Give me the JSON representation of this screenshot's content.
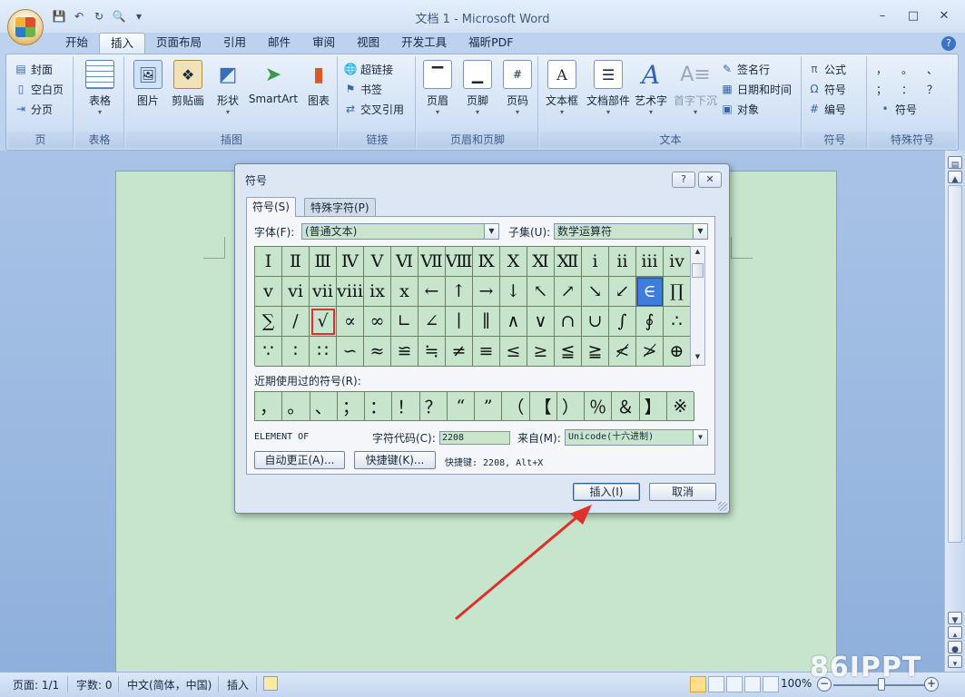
{
  "window": {
    "title": "文档 1 - Microsoft Word",
    "minimize": "–",
    "maximize": "□",
    "close": "✕"
  },
  "qat": {
    "save": "💾",
    "undo": "↶",
    "redo": "↻",
    "print_preview": "🔍",
    "customize": "▾"
  },
  "tabs": [
    "开始",
    "插入",
    "页面布局",
    "引用",
    "邮件",
    "审阅",
    "视图",
    "开发工具",
    "福昕PDF"
  ],
  "active_tab": "插入",
  "help": "?",
  "ribbon": {
    "page": {
      "label": "页",
      "items": [
        "封面",
        "空白页",
        "分页"
      ]
    },
    "table": {
      "label": "表格",
      "button": "表格"
    },
    "illustrations": {
      "label": "插图",
      "items": [
        "图片",
        "剪贴画",
        "形状",
        "SmartArt",
        "图表"
      ]
    },
    "links": {
      "label": "链接",
      "items": [
        "超链接",
        "书签",
        "交叉引用"
      ]
    },
    "header_footer": {
      "label": "页眉和页脚",
      "items": [
        "页眉",
        "页脚",
        "页码"
      ]
    },
    "text": {
      "label": "文本",
      "items": [
        "文本框",
        "文档部件",
        "艺术字",
        "首字下沉"
      ],
      "small": [
        "签名行",
        "日期和时间",
        "对象"
      ]
    },
    "symbols": {
      "label": "符号",
      "items": [
        "公式",
        "符号",
        "编号"
      ]
    },
    "special": {
      "label": "特殊符号",
      "glyphs": [
        "，",
        "。",
        "、",
        "；",
        "：",
        "？"
      ],
      "button": "符号"
    }
  },
  "dialog": {
    "title": "符号",
    "help": "?",
    "close": "✕",
    "tabs": [
      "符号(S)",
      "特殊字符(P)"
    ],
    "font_label": "字体(F):",
    "font_value": "(普通文本)",
    "subset_label": "子集(U):",
    "subset_value": "数学运算符",
    "symbols": [
      "Ⅰ",
      "Ⅱ",
      "Ⅲ",
      "Ⅳ",
      "Ⅴ",
      "Ⅵ",
      "Ⅶ",
      "Ⅷ",
      "Ⅸ",
      "Ⅹ",
      "Ⅺ",
      "Ⅻ",
      "ⅰ",
      "ⅱ",
      "ⅲ",
      "ⅳ",
      "ⅴ",
      "ⅵ",
      "ⅶ",
      "ⅷ",
      "ⅸ",
      "ⅹ",
      "←",
      "↑",
      "→",
      "↓",
      "↖",
      "↗",
      "↘",
      "↙",
      "∈",
      "∏",
      "∑",
      "∕",
      "√",
      "∝",
      "∞",
      "∟",
      "∠",
      "∣",
      "∥",
      "∧",
      "∨",
      "∩",
      "∪",
      "∫",
      "∮",
      "∴",
      "∵",
      "∶",
      "∷",
      "∽",
      "≈",
      "≌",
      "≒",
      "≠",
      "≡",
      "≤",
      "≥",
      "≦",
      "≧",
      "≮",
      "≯",
      "⊕"
    ],
    "selected_index": 30,
    "highlighted_index": 34,
    "recent_label": "近期使用过的符号(R):",
    "recent": [
      "，",
      "。",
      "、",
      "；",
      "：",
      "！",
      "？",
      "“",
      "”",
      "（",
      "【",
      "）",
      "％",
      "＆",
      "】",
      "※"
    ],
    "char_name": "ELEMENT OF",
    "char_code_label": "字符代码(C):",
    "char_code": "2208",
    "from_label": "来自(M):",
    "from_value": "Unicode(十六进制)",
    "autocorrect_button": "自动更正(A)...",
    "shortcut_button": "快捷键(K)...",
    "shortcut_text": "快捷键: 2208, Alt+X",
    "insert_button": "插入(I)",
    "cancel_button": "取消"
  },
  "status": {
    "page": "页面: 1/1",
    "words": "字数: 0",
    "language": "中文(简体，中国)",
    "mode": "插入",
    "zoom": "100%",
    "zoom_level": 0.5
  },
  "watermark": "86IPPT",
  "colors": {
    "annotation_red": "#e0302a",
    "selection_blue": "#3d7de0",
    "cell_green": "#c7e5cc"
  }
}
